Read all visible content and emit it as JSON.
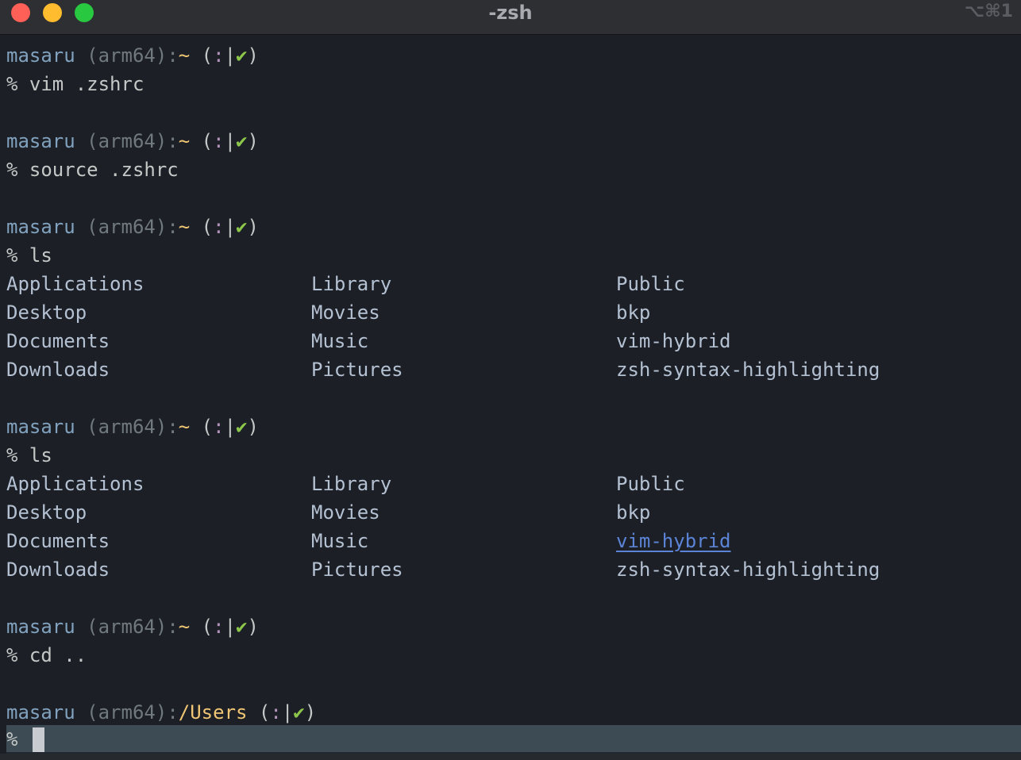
{
  "window": {
    "title": "-zsh",
    "shortcut": "⌥⌘1"
  },
  "prompt": {
    "user": "masaru",
    "arch": "(arm64)",
    "home_path": "~",
    "users_path": "/Users",
    "status_open": "(",
    "smile": ":",
    "bar": "|",
    "check": "✔",
    "status_close": ")",
    "symbol": "%"
  },
  "commands": [
    {
      "text": "vim .zshrc"
    },
    {
      "text": "source .zshrc"
    },
    {
      "text": "ls"
    },
    {
      "text": "ls"
    },
    {
      "text": "cd .."
    }
  ],
  "ls_output": {
    "column1": [
      "Applications",
      "Desktop",
      "Documents",
      "Downloads"
    ],
    "column2": [
      "Library",
      "Movies",
      "Music",
      "Pictures"
    ],
    "column3": [
      "Public",
      "bkp",
      "vim-hybrid",
      "zsh-syntax-highlighting"
    ]
  },
  "current_input": "",
  "colors": {
    "user": "#81a2be",
    "path": "#f0c674",
    "check": "#8cc64a",
    "smile": "#b294bb",
    "link": "#5b84d6",
    "background": "#1c1f26"
  }
}
